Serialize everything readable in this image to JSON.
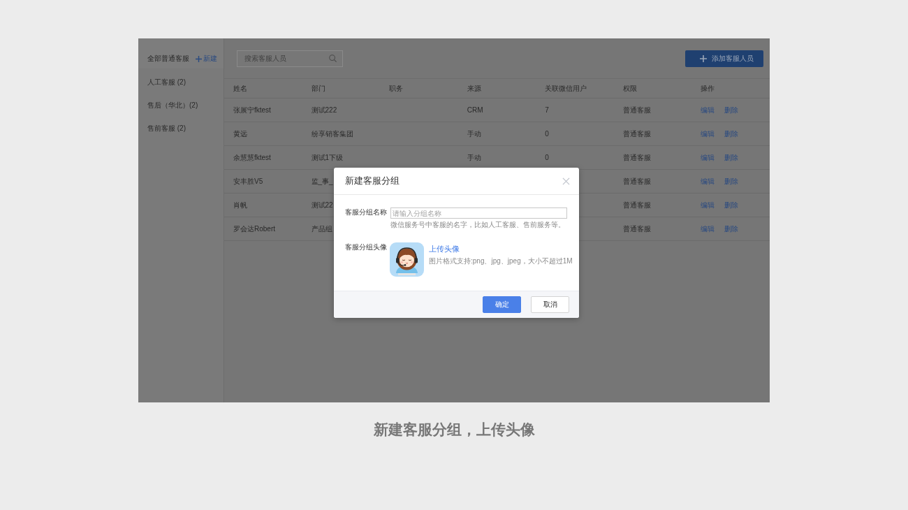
{
  "sidebar": {
    "header": "全部普通客服",
    "new_link": "新建",
    "items": [
      "人工客服 (2)",
      "售后（华北）(2)",
      "售前客服 (2)"
    ]
  },
  "toolbar": {
    "search": {
      "placeholder": "搜索客服人员"
    },
    "add_button": "添加客服人员"
  },
  "table": {
    "columns": [
      "姓名",
      "部门",
      "职务",
      "来源",
      "关联微信用户",
      "权限",
      "操作"
    ],
    "rows": [
      {
        "name": "张展宁fktest",
        "department": "测试222",
        "source": "CRM",
        "wechat_users": "7",
        "permission": "普通客服",
        "actions": [
          "编辑",
          "删除"
        ]
      },
      {
        "name": "黄远",
        "department": "纷享销客集团",
        "source": "手动",
        "wechat_users": "0",
        "permission": "普通客服",
        "actions": [
          "编辑",
          "删除"
        ]
      },
      {
        "name": "余慧慧fktest",
        "department": "测试1下级",
        "source": "手动",
        "wechat_users": "0",
        "permission": "普通客服",
        "actions": [
          "编辑",
          "删除"
        ]
      },
      {
        "name": "安丰胜V5",
        "department": "监_事_",
        "permission": "普通客服",
        "actions": [
          "编辑",
          "删除"
        ]
      },
      {
        "name": "肖帆",
        "department": "测试22",
        "permission": "普通客服",
        "actions": [
          "编辑",
          "删除"
        ]
      },
      {
        "name": "罗会达Robert",
        "department": "产品组",
        "permission": "普通客服",
        "actions": [
          "编辑",
          "删除"
        ]
      }
    ]
  },
  "dialog": {
    "title": "新建客服分组",
    "fields": [
      {
        "kind": "text",
        "label": "客服分组名称",
        "placeholder": "请输入分组名称",
        "hint": "微信服务号中客服的名字，比如人工客服、售前服务等。"
      },
      {
        "kind": "avatar",
        "label": "客服分组头像",
        "link": "上传头像",
        "hint": "图片格式支持:png、jpg、jpeg，大小不超过1M"
      }
    ],
    "buttons": [
      {
        "kind": "primary",
        "label": "确定"
      },
      {
        "kind": "default",
        "label": "取消"
      }
    ]
  },
  "caption": "新建客服分组，上传头像"
}
